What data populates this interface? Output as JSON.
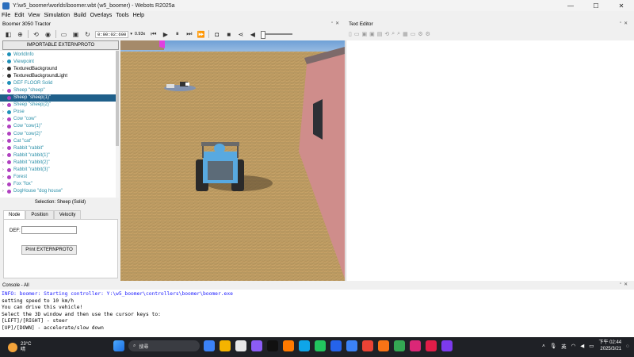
{
  "window": {
    "title": "Y:\\w5_boomer\\worlds\\boomer.wbt (w5_boomer) - Webots R2025a",
    "controls": [
      "—",
      "☐",
      "✕"
    ]
  },
  "menu": [
    "File",
    "Edit",
    "View",
    "Simulation",
    "Build",
    "Overlays",
    "Tools",
    "Help"
  ],
  "scene_panel": {
    "title": "Boomer 3050 Tractor"
  },
  "text_panel": {
    "title": "Text Editor"
  },
  "toolbar": {
    "time": "0:00:02:600",
    "speed": "0.93x",
    "icons": [
      "scene-tree-toggle-icon",
      "add-node-icon",
      "reload-world-icon",
      "view-icon",
      "open-icon",
      "save-icon",
      "revert-icon",
      "step-back-icon",
      "play-icon",
      "pause-icon",
      "step-icon",
      "fast-forward-icon",
      "screenshot-icon",
      "record-icon",
      "share-icon",
      "volume-icon"
    ]
  },
  "extern_button": "IMPORTABLE EXTERNPROTO",
  "scene_tree": [
    {
      "label": "WorldInfo",
      "dot": "#1e90b8",
      "color": "teal"
    },
    {
      "label": "Viewpoint",
      "dot": "#1e90b8",
      "color": "teal"
    },
    {
      "label": "TexturedBackground",
      "dot": "#333",
      "color": "black"
    },
    {
      "label": "TexturedBackgroundLight",
      "dot": "#333",
      "color": "black"
    },
    {
      "label": "DEF FLOOR Solid",
      "dot": "#1e90b8",
      "color": "teal"
    },
    {
      "label": "Sheep \"sheep\"",
      "dot": "#b040c0",
      "color": "teal"
    },
    {
      "label": "Sheep \"sheep(1)\"",
      "dot": "#b040c0",
      "color": "teal",
      "selected": true
    },
    {
      "label": "Sheep \"sheep(2)\"",
      "dot": "#b040c0",
      "color": "teal"
    },
    {
      "label": "Pose",
      "dot": "#1e90b8",
      "color": "teal"
    },
    {
      "label": "Cow \"cow\"",
      "dot": "#b040c0",
      "color": "teal"
    },
    {
      "label": "Cow \"cow(1)\"",
      "dot": "#b040c0",
      "color": "teal"
    },
    {
      "label": "Cow \"cow(2)\"",
      "dot": "#b040c0",
      "color": "teal"
    },
    {
      "label": "Cat \"cat\"",
      "dot": "#b040c0",
      "color": "teal"
    },
    {
      "label": "Rabbit \"rabbit\"",
      "dot": "#b040c0",
      "color": "teal"
    },
    {
      "label": "Rabbit \"rabbit(1)\"",
      "dot": "#b040c0",
      "color": "teal"
    },
    {
      "label": "Rabbit \"rabbit(2)\"",
      "dot": "#b040c0",
      "color": "teal"
    },
    {
      "label": "Rabbit \"rabbit(3)\"",
      "dot": "#b040c0",
      "color": "teal"
    },
    {
      "label": "Forest",
      "dot": "#b040c0",
      "color": "teal"
    },
    {
      "label": "Fox \"fox\"",
      "dot": "#b040c0",
      "color": "teal"
    },
    {
      "label": "DogHouse \"dog house\"",
      "dot": "#b040c0",
      "color": "teal"
    }
  ],
  "selection": "Selection: Sheep (Solid)",
  "tabs": [
    "Node",
    "Position",
    "Velocity"
  ],
  "def_label": "DEF:",
  "def_value": "",
  "print_button": "Print EXTERNPROTO",
  "console": {
    "title": "Console - All",
    "lines": [
      {
        "text": "INFO: boomer: Starting controller: Y:\\w5_boomer\\controllers\\boomer\\boomer.exe",
        "info": true
      },
      {
        "text": "setting speed to 10 km/h"
      },
      {
        "text": "You can drive this vehicle!"
      },
      {
        "text": "Select the 3D window and then use the cursor keys to:"
      },
      {
        "text": "[LEFT]/[RIGHT] - steer"
      },
      {
        "text": "[UP]/[DOWN] - accelerate/slow down"
      }
    ]
  },
  "taskbar": {
    "weather_temp": "23°C",
    "weather_desc": "晴",
    "search_placeholder": "搜尋",
    "ime": "英",
    "time": "下午 02:44",
    "date": "2025/3/21",
    "apps": [
      "#3b82f6",
      "#f4b400",
      "#e8e8e8",
      "#8b5cf6",
      "#111",
      "#ff7a00",
      "#0ea5e9",
      "#22c55e",
      "#2563eb",
      "#3b82f6",
      "#ea4335",
      "#f97316",
      "#34a853",
      "#db2777",
      "#e11d48",
      "#7c3aed"
    ]
  }
}
